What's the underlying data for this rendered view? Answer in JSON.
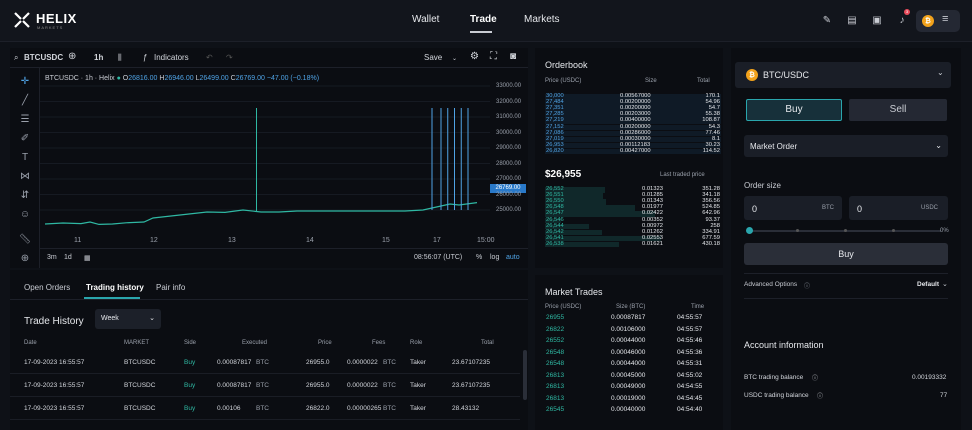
{
  "brand": {
    "name": "HELIX",
    "sub": "MARKETS"
  },
  "nav": [
    "Wallet",
    "Trade",
    "Markets"
  ],
  "chart_toolbar": {
    "symbol": "BTCUSDC",
    "interval": "1h",
    "indicators": "Indicators",
    "save": "Save"
  },
  "chart_info": {
    "title": "BTCUSDC · 1h · Helix",
    "o_label": "O",
    "o": "26816.00",
    "h_label": "H",
    "h": "26946.00",
    "l_label": "L",
    "l": "26499.00",
    "c_label": "C",
    "c": "26769.00",
    "chg": "−47.00 (−0.18%)"
  },
  "chart_data": {
    "type": "line",
    "y_ticks": [
      "33000.00",
      "32000.00",
      "31000.00",
      "30000.00",
      "29000.00",
      "28000.00",
      "27000.00",
      "26000.00",
      "25000.00"
    ],
    "x_ticks": [
      "11",
      "12",
      "13",
      "14",
      "15",
      "17",
      "15:00"
    ],
    "last_price": "26769.00",
    "ylim": [
      24500,
      33500
    ],
    "points": [
      [
        0,
        25700
      ],
      [
        0.04,
        25750
      ],
      [
        0.08,
        25720
      ],
      [
        0.1,
        25800
      ],
      [
        0.12,
        25680
      ],
      [
        0.15,
        25700
      ],
      [
        0.18,
        25760
      ],
      [
        0.22,
        25800
      ],
      [
        0.24,
        26000
      ],
      [
        0.28,
        26100
      ],
      [
        0.32,
        26200
      ],
      [
        0.36,
        26300
      ],
      [
        0.4,
        26280
      ],
      [
        0.44,
        26400
      ],
      [
        0.48,
        26300
      ],
      [
        0.52,
        26300
      ],
      [
        0.56,
        26350
      ],
      [
        0.6,
        26350
      ],
      [
        0.64,
        26350
      ],
      [
        0.68,
        26350
      ],
      [
        0.72,
        26350
      ],
      [
        0.76,
        26350
      ],
      [
        0.8,
        26350
      ],
      [
        0.84,
        26400
      ],
      [
        0.86,
        26500
      ],
      [
        0.88,
        26600
      ],
      [
        0.9,
        26700
      ],
      [
        0.92,
        26650
      ],
      [
        0.96,
        26769
      ]
    ]
  },
  "chart_bottom": {
    "r1": "3m",
    "r2": "1d",
    "time": "08:56:07 (UTC)",
    "pct": "%",
    "log": "log",
    "auto": "auto"
  },
  "tabs": [
    "Open Orders",
    "Trading history",
    "Pair info"
  ],
  "history": {
    "title": "Trade History",
    "period": "Week",
    "headers": [
      "Date",
      "MARKET",
      "Side",
      "Executed",
      "Price",
      "Fees",
      "Role",
      "Total"
    ],
    "rows": [
      [
        "17-09-2023 16:55:57",
        "BTCUSDC",
        "Buy",
        "0.00087817",
        "BTC",
        "26955.0",
        "0.0000022",
        "BTC",
        "Taker",
        "23.67107235"
      ],
      [
        "17-09-2023 16:55:57",
        "BTCUSDC",
        "Buy",
        "0.00087817",
        "BTC",
        "26955.0",
        "0.0000022",
        "BTC",
        "Taker",
        "23.67107235"
      ],
      [
        "17-09-2023 16:55:57",
        "BTCUSDC",
        "Buy",
        "0.00106",
        "BTC",
        "26822.0",
        "0.00000265",
        "BTC",
        "Taker",
        "28.43132"
      ]
    ]
  },
  "orderbook": {
    "title": "Orderbook",
    "headers": [
      "Price (USDC)",
      "Size",
      "Total"
    ],
    "asks": [
      [
        "30,000",
        "0.00567000",
        "170.1"
      ],
      [
        "27,484",
        "0.00200000",
        "54.96"
      ],
      [
        "27,351",
        "0.00200000",
        "54.7"
      ],
      [
        "27,285",
        "0.00203000",
        "55.38"
      ],
      [
        "27,219",
        "0.00400000",
        "108.87"
      ],
      [
        "27,152",
        "0.00200000",
        "54.3"
      ],
      [
        "27,086",
        "0.00286000",
        "77.46"
      ],
      [
        "27,019",
        "0.00030000",
        "8.1"
      ],
      [
        "26,953",
        "0.00112183",
        "30.23"
      ],
      [
        "26,820",
        "0.00427000",
        "114.52"
      ]
    ],
    "mid": "$26,955",
    "mid_label": "Last traded price",
    "bids": [
      [
        "26,552",
        "0.01323",
        "351.28"
      ],
      [
        "26,551",
        "0.01285",
        "341.18"
      ],
      [
        "26,550",
        "0.01343",
        "356.56"
      ],
      [
        "26,548",
        "0.01977",
        "524.85"
      ],
      [
        "26,547",
        "0.02422",
        "642.96"
      ],
      [
        "26,546",
        "0.00352",
        "93.37"
      ],
      [
        "26,544",
        "0.00972",
        "258"
      ],
      [
        "26,542",
        "0.01262",
        "334.91"
      ],
      [
        "26,541",
        "0.02553",
        "677.59"
      ],
      [
        "26,538",
        "0.01621",
        "430.18"
      ]
    ]
  },
  "market_trades": {
    "title": "Market Trades",
    "headers": [
      "Price (USDC)",
      "Size (BTC)",
      "Time"
    ],
    "rows": [
      [
        "26955",
        "0.00087817",
        "04:55:57"
      ],
      [
        "26822",
        "0.00106000",
        "04:55:57"
      ],
      [
        "26552",
        "0.00044000",
        "04:55:46"
      ],
      [
        "26548",
        "0.00046000",
        "04:55:36"
      ],
      [
        "26548",
        "0.00044000",
        "04:55:31"
      ],
      [
        "26813",
        "0.00045000",
        "04:55:02"
      ],
      [
        "26813",
        "0.00049000",
        "04:54:55"
      ],
      [
        "26813",
        "0.00019000",
        "04:54:45"
      ],
      [
        "26545",
        "0.00040000",
        "04:54:40"
      ]
    ]
  },
  "order": {
    "pair": "BTC/USDC",
    "buy": "Buy",
    "sell": "Sell",
    "type": "Market Order",
    "size_label": "Order size",
    "amount": "0",
    "amount_unit": "BTC",
    "quote": "0",
    "quote_unit": "USDC",
    "pct": "0%",
    "submit": "Buy",
    "adv": "Advanced Options",
    "adv_val": "Default"
  },
  "account": {
    "title": "Account information",
    "btc_label": "BTC trading balance",
    "btc": "0.00193332",
    "usdc_label": "USDC trading balance",
    "usdc": "77"
  },
  "colors": {
    "accent": "#2aa6ad",
    "buy": "#2fb8a3",
    "ask": "#4fa3e5",
    "sell": "#e94b5b"
  }
}
